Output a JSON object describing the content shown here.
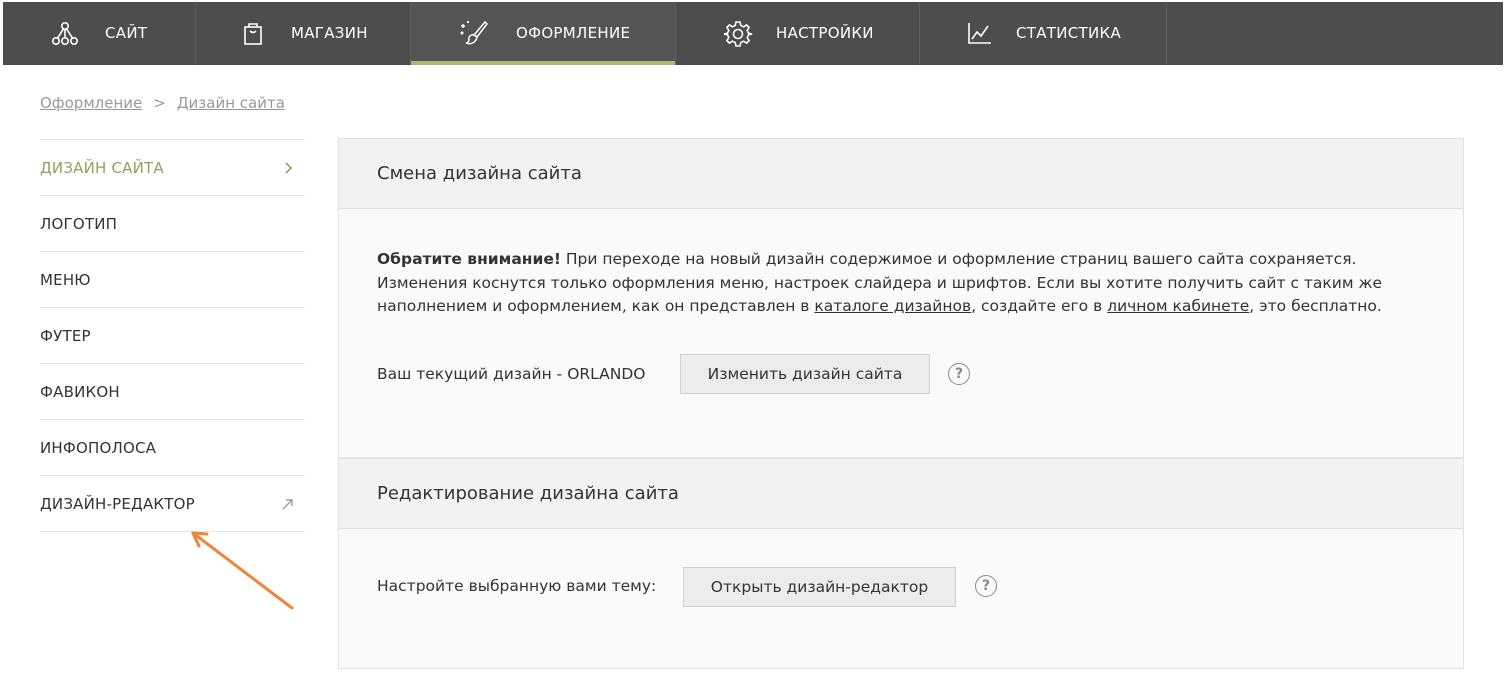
{
  "topnav": {
    "tabs": [
      {
        "label": "САЙТ",
        "icon": "sitemap-icon"
      },
      {
        "label": "МАГАЗИН",
        "icon": "shopping-bag-icon"
      },
      {
        "label": "ОФОРМЛЕНИЕ",
        "icon": "brush-icon",
        "active": true
      },
      {
        "label": "НАСТРОЙКИ",
        "icon": "gear-icon"
      },
      {
        "label": "СТАТИСТИКА",
        "icon": "chart-icon"
      }
    ],
    "accent": "#a9b879",
    "background": "#4d4d4d"
  },
  "breadcrumb": {
    "items": [
      "Оформление",
      "Дизайн сайта"
    ],
    "separator": ">"
  },
  "sidebar": {
    "items": [
      {
        "label": "ДИЗАЙН САЙТА",
        "active": true,
        "icon": "chevron-right-icon"
      },
      {
        "label": "ЛОГОТИП"
      },
      {
        "label": "МЕНЮ"
      },
      {
        "label": "ФУТЕР"
      },
      {
        "label": "ФАВИКОН"
      },
      {
        "label": "ИНФОПОЛОСА"
      },
      {
        "label": "ДИЗАЙН-РЕДАКТОР",
        "icon": "external-link-icon"
      }
    ],
    "active_color": "#8fa35c"
  },
  "change_design": {
    "title": "Смена дизайна сайта",
    "notice_bold": "Обратите внимание!",
    "notice_text_1": " При переходе на новый дизайн содержимое и оформление страниц вашего сайта сохраняется. Изменения коснутся только оформления меню, настроек слайдера и шрифтов. Если вы хотите получить сайт с таким же наполнением и оформлением, как он представлен в ",
    "catalog_link": "каталоге дизайнов",
    "notice_text_2": ", создайте его в ",
    "cabinet_link": "личном кабинете",
    "notice_text_3": ", это бесплатно.",
    "current_label": "Ваш текущий дизайн - ORLANDO",
    "button_label": "Изменить дизайн сайта",
    "help": "?"
  },
  "edit_design": {
    "title": "Редактирование дизайна сайта",
    "label": "Настройте выбранную вами тему:",
    "button_label": "Открыть дизайн-редактор",
    "help": "?"
  },
  "annotation": {
    "color": "#f0843c",
    "icon": "arrow-annotation-icon"
  }
}
